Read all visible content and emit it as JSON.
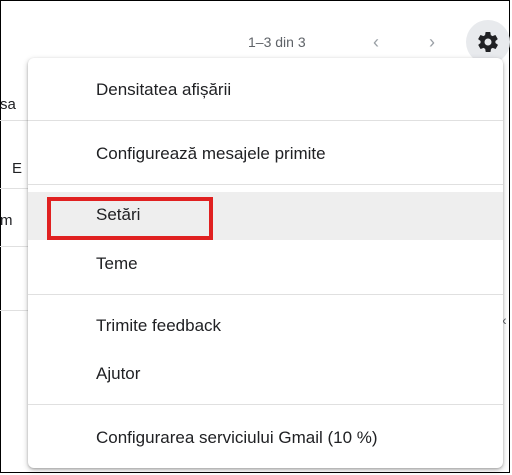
{
  "pager": {
    "text": "1–3 din 3",
    "prev_icon": "‹",
    "next_icon": "›"
  },
  "settings_icon": "gear-icon",
  "background": {
    "snippets": [
      "sa",
      "E",
      "m"
    ]
  },
  "menu": {
    "items": [
      {
        "label": "Densitatea afișării"
      },
      {
        "label": "Configurează mesajele primite"
      },
      {
        "label": "Setări"
      },
      {
        "label": "Teme"
      },
      {
        "label": "Trimite feedback"
      },
      {
        "label": "Ajutor"
      },
      {
        "label": "Configurarea serviciului Gmail (10 %)"
      }
    ],
    "highlighted_item": "Setări"
  },
  "annotation_color": "#e02020"
}
